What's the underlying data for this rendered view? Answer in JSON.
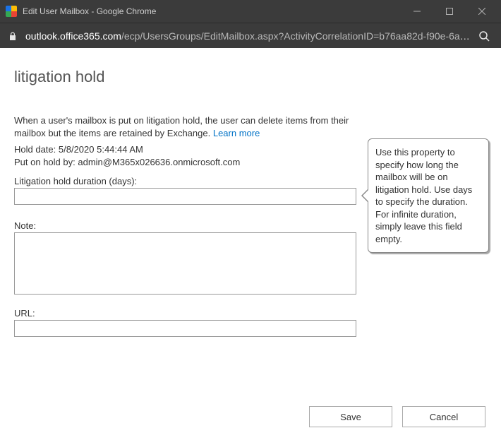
{
  "window": {
    "title": "Edit User Mailbox - Google Chrome"
  },
  "url": {
    "host": "outlook.office365.com",
    "path": "/ecp/UsersGroups/EditMailbox.aspx?ActivityCorrelationID=b76aa82d-f90e-6a5…"
  },
  "page": {
    "title": "litigation hold",
    "intro_line1": "When a user's mailbox is put on litigation hold, the user can delete items from",
    "intro_line2": "their mailbox but the items are retained by Exchange.",
    "learn_more": "Learn more",
    "hold_date_label": "Hold date:",
    "hold_date_value": "5/8/2020 5:44:44 AM",
    "put_on_hold_label": "Put on hold by:",
    "put_on_hold_value": "admin@M365x026636.onmicrosoft.com",
    "duration_label": "Litigation hold duration (days):",
    "duration_value": "",
    "note_label": "Note:",
    "note_value": "",
    "url_label": "URL:",
    "url_value": ""
  },
  "tooltip": {
    "text": "Use this property to specify how long the mailbox will be on litigation hold. Use days to specify the duration. For infinite duration, simply leave this field empty."
  },
  "buttons": {
    "save": "Save",
    "cancel": "Cancel"
  }
}
